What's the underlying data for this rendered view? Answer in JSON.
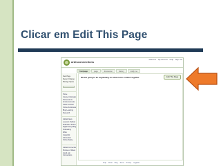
{
  "slide": {
    "title": "Clicar em Edit This Page"
  },
  "wiki": {
    "name": "ardisconnections",
    "top_nav": [
      "wherever",
      "My Account",
      "Help",
      "Sign Out"
    ],
    "tabs": [
      {
        "label": "frontpage",
        "active": true
      },
      {
        "label": "page",
        "active": false
      },
      {
        "label": "discussion",
        "active": false
      },
      {
        "label": "history",
        "active": false
      },
      {
        "label": "notify me",
        "active": false
      }
    ],
    "sidebar": {
      "buttons": [
        "New Page",
        "Recent Changes",
        "Manage Space"
      ],
      "nav_group_1": [
        "Home",
        "Course Information",
        "Homework &",
        "Announcements",
        "Class Contract",
        "Online Submission",
        "Blog Learning",
        "Research"
      ],
      "nav_group_2": [
        "Global News",
        "Lesson's Toolbox",
        "Evaluation Protocol",
        "Digital Storytelling",
        "Podcasting",
        "Wikis",
        "Copyright",
        "Information",
        "Online Safety"
      ],
      "nav_group_3": [
        "Global Connections",
        "Pictures of Week",
        "Ask & ask",
        "Connections"
      ]
    },
    "content_text": "We are going to be negotiating our classroom contract together",
    "edit_button_label": "Edit This Page",
    "footer_links": [
      "Help",
      "About",
      "Blog",
      "Terms",
      "Privacy",
      "Upgrade"
    ]
  },
  "colors": {
    "arrow_fill": "#ee7a2a",
    "arrow_stroke": "#b84f12",
    "title_color": "#2f4f6f",
    "rule_color": "#1f3a56",
    "side_stripe": "#d6e4c2"
  },
  "icons": {
    "logo": "wiki-logo-icon",
    "pointer": "arrow-left-icon"
  }
}
